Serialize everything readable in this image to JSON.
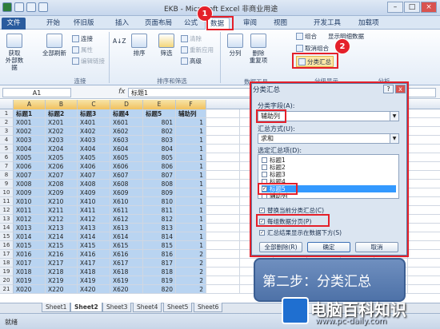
{
  "window": {
    "title": "EKB - Microsoft Excel 非商业用途"
  },
  "tabs": {
    "file": "文件",
    "home": "开始",
    "layout": "怀旧版",
    "insert": "插入",
    "page": "页面布局",
    "formula": "公式",
    "data": "数据",
    "review": "审阅",
    "view": "视图",
    "dev": "开发工具",
    "addins": "加载项"
  },
  "ribbon": {
    "external": "获取\n外部数据",
    "refresh": "全部刷新",
    "connections": "连接",
    "properties": "属性",
    "edit_links": "编辑链接",
    "group_connections": "连接",
    "sort_az": "A↓Z",
    "sort": "排序",
    "filter": "筛选",
    "clear": "清除",
    "reapply": "重新应用",
    "advanced": "高级",
    "group_sort": "排序和筛选",
    "split": "分列",
    "remove_dup": "删除\n重复项",
    "group_data": "数据工具",
    "group_btn": "组合",
    "ungroup_btn": "取消组合",
    "subtotal_btn": "分类汇总",
    "show_detail": "显示明细数据",
    "group_outline": "分级显示",
    "analysis": "分析"
  },
  "formula_bar": {
    "name_box": "A1",
    "fx": "fx",
    "content": "标题1"
  },
  "columns": [
    "A",
    "B",
    "C",
    "D",
    "E",
    "F"
  ],
  "rows": [
    [
      "标题1",
      "标题2",
      "标题3",
      "标题4",
      "标题5",
      "辅助列"
    ],
    [
      "X001",
      "X201",
      "X401",
      "X601",
      "801",
      "1"
    ],
    [
      "X002",
      "X202",
      "X402",
      "X602",
      "802",
      "1"
    ],
    [
      "X003",
      "X203",
      "X403",
      "X603",
      "803",
      "1"
    ],
    [
      "X004",
      "X204",
      "X404",
      "X604",
      "804",
      "1"
    ],
    [
      "X005",
      "X205",
      "X405",
      "X605",
      "805",
      "1"
    ],
    [
      "X006",
      "X206",
      "X406",
      "X606",
      "806",
      "1"
    ],
    [
      "X007",
      "X207",
      "X407",
      "X607",
      "807",
      "1"
    ],
    [
      "X008",
      "X208",
      "X408",
      "X608",
      "808",
      "1"
    ],
    [
      "X009",
      "X209",
      "X409",
      "X609",
      "809",
      "1"
    ],
    [
      "X010",
      "X210",
      "X410",
      "X610",
      "810",
      "1"
    ],
    [
      "X011",
      "X211",
      "X411",
      "X611",
      "811",
      "1"
    ],
    [
      "X012",
      "X212",
      "X412",
      "X612",
      "812",
      "1"
    ],
    [
      "X013",
      "X213",
      "X413",
      "X613",
      "813",
      "1"
    ],
    [
      "X014",
      "X214",
      "X414",
      "X614",
      "814",
      "1"
    ],
    [
      "X015",
      "X215",
      "X415",
      "X615",
      "815",
      "1"
    ],
    [
      "X016",
      "X216",
      "X416",
      "X616",
      "816",
      "2"
    ],
    [
      "X017",
      "X217",
      "X417",
      "X617",
      "817",
      "2"
    ],
    [
      "X018",
      "X218",
      "X418",
      "X618",
      "818",
      "2"
    ],
    [
      "X019",
      "X219",
      "X419",
      "X619",
      "819",
      "2"
    ],
    [
      "X020",
      "X220",
      "X420",
      "X620",
      "820",
      "2"
    ]
  ],
  "row_numbers": [
    "1",
    "2",
    "3",
    "4",
    "5",
    "6",
    "7",
    "8",
    "9",
    "10",
    "11",
    "12",
    "13",
    "14",
    "15",
    "16",
    "17",
    "18",
    "19",
    "20",
    "21"
  ],
  "sheets": [
    "Sheet1",
    "Sheet2",
    "Sheet3",
    "Sheet4",
    "Sheet5",
    "Sheet6"
  ],
  "status": {
    "ready": "就绪"
  },
  "dialog": {
    "title": "分类汇总",
    "help": "?",
    "close": "x",
    "group_by_label": "分类字段(A):",
    "group_by_value": "辅助列",
    "function_label": "汇总方式(U):",
    "function_value": "求和",
    "items_label": "选定汇总项(D):",
    "items": [
      {
        "label": "标题1",
        "checked": false
      },
      {
        "label": "标题2",
        "checked": false
      },
      {
        "label": "标题3",
        "checked": false
      },
      {
        "label": "标题4",
        "checked": false
      },
      {
        "label": "标题5",
        "checked": true
      },
      {
        "label": "辅助列",
        "checked": false
      }
    ],
    "replace": "替换当前分类汇总(C)",
    "page_break": "每组数据分页(P)",
    "summary_below": "汇总结果显示在数据下方(S)",
    "remove_all": "全部删除(R)",
    "ok": "确定",
    "cancel": "取消"
  },
  "annotations": {
    "step1": "1",
    "step2": "2",
    "callout": "第二步：分类汇总"
  },
  "watermark": {
    "text": "电脑百科知识",
    "url": "www.pc-daily.com"
  },
  "colors": {
    "accent": "#2a5c9e",
    "highlight": "#b9d4f1",
    "marker": "#e4202a"
  }
}
